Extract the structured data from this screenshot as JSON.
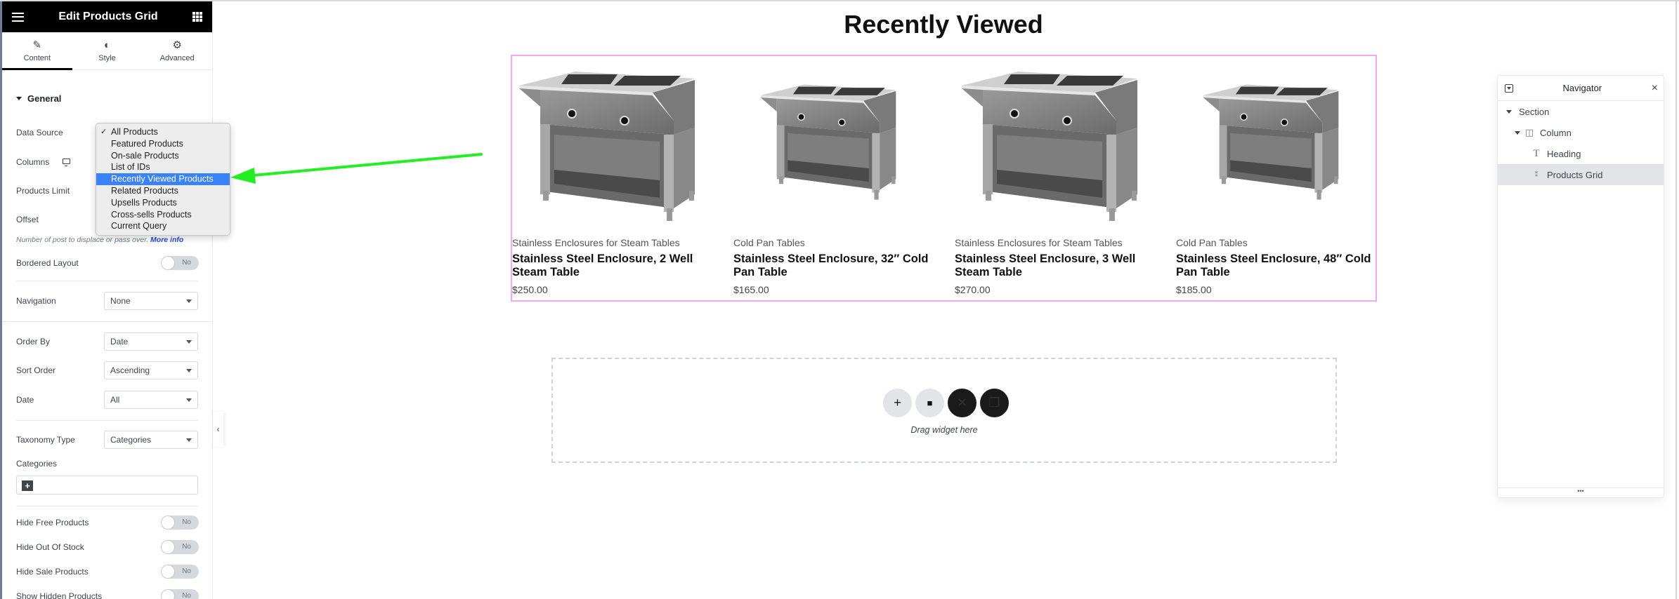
{
  "panel": {
    "title": "Edit Products Grid",
    "tabs": [
      {
        "label": "Content",
        "icon": "pencil-icon",
        "active": true
      },
      {
        "label": "Style",
        "icon": "contrast-icon",
        "active": false
      },
      {
        "label": "Advanced",
        "icon": "gear-icon",
        "active": false
      }
    ],
    "section_title": "General",
    "labels": {
      "data_source": "Data Source",
      "columns": "Columns",
      "products_limit": "Products Limit",
      "offset": "Offset",
      "bordered_layout": "Bordered Layout",
      "navigation": "Navigation",
      "order_by": "Order By",
      "sort_order": "Sort Order",
      "date": "Date",
      "taxonomy_type": "Taxonomy Type",
      "categories": "Categories",
      "hide_free": "Hide Free Products",
      "hide_out_of_stock": "Hide Out Of Stock",
      "hide_sale": "Hide Sale Products",
      "show_hidden": "Show Hidden Products"
    },
    "help_text": "Number of post to displace or pass over.",
    "help_link": "More info",
    "values": {
      "navigation": "None",
      "order_by": "Date",
      "sort_order": "Ascending",
      "date": "All",
      "taxonomy_type": "Categories"
    },
    "toggle_off_label": "No",
    "add_symbol": "+",
    "collapse_symbol": "‹"
  },
  "dropdown": {
    "checked": "All Products",
    "highlighted": "Recently Viewed Products",
    "options": [
      "All Products",
      "Featured Products",
      "On-sale Products",
      "List of IDs",
      "Recently Viewed Products",
      "Related Products",
      "Upsells Products",
      "Cross-sells Products",
      "Current Query"
    ]
  },
  "annotation": {
    "arrow_color": "#22ee22"
  },
  "canvas": {
    "heading": "Recently Viewed",
    "grid_border_color": "#f0a6f0",
    "products": [
      {
        "category": "Stainless Enclosures for Steam Tables",
        "title": "Stainless Steel Enclosure, 2 Well Steam Table",
        "price": "$250.00"
      },
      {
        "category": "Cold Pan Tables",
        "title": "Stainless Steel Enclosure, 32″ Cold Pan Table",
        "price": "$165.00"
      },
      {
        "category": "Stainless Enclosures for Steam Tables",
        "title": "Stainless Steel Enclosure, 3 Well Steam Table",
        "price": "$270.00"
      },
      {
        "category": "Cold Pan Tables",
        "title": "Stainless Steel Enclosure, 48″ Cold Pan Table",
        "price": "$185.00"
      }
    ],
    "dropzone": {
      "text": "Drag widget here",
      "buttons": [
        {
          "name": "add-section",
          "icon": "plus-icon",
          "symbol": "+"
        },
        {
          "name": "add-template",
          "icon": "folder-icon",
          "symbol": "■"
        },
        {
          "name": "elementskit",
          "icon": "x-logo-icon",
          "symbol": "✕"
        },
        {
          "name": "copy",
          "icon": "copy-icon",
          "symbol": "❐"
        }
      ]
    }
  },
  "navigator": {
    "title": "Navigator",
    "close_symbol": "×",
    "footer": "•••",
    "items": [
      {
        "label": "Section",
        "icon": "",
        "level": 0,
        "expanded": true
      },
      {
        "label": "Column",
        "icon": "column-icon",
        "level": 1,
        "expanded": true
      },
      {
        "label": "Heading",
        "icon": "heading-icon",
        "level": 2
      },
      {
        "label": "Products Grid",
        "icon": "products-grid-icon",
        "level": 2,
        "selected": true
      }
    ]
  }
}
